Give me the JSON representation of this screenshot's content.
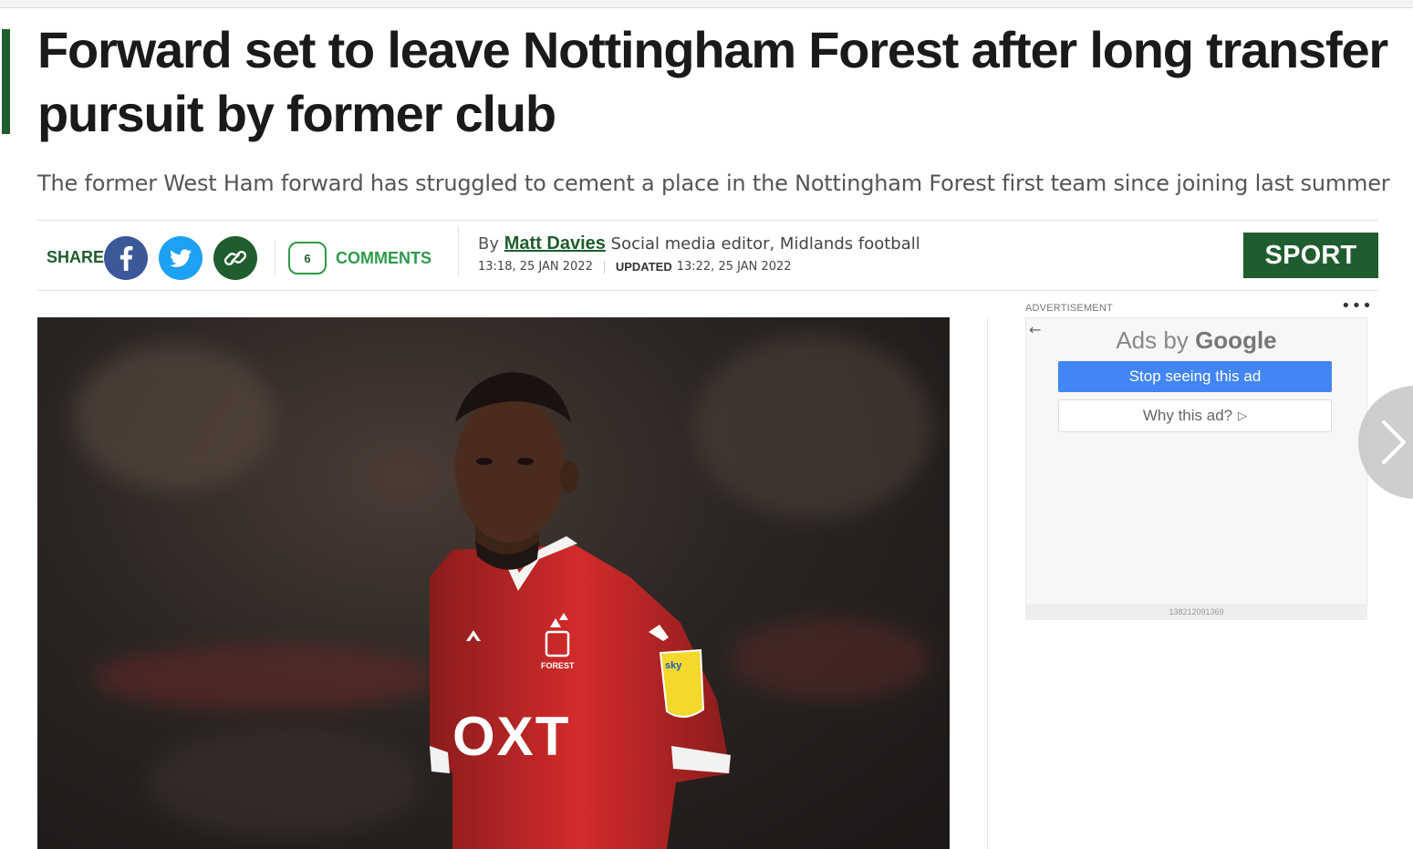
{
  "article": {
    "headline": "Forward set to leave Nottingham Forest after long transfer pursuit by former club",
    "standfirst": "The former West Ham forward has struggled to cement a place in the Nottingham Forest first team since joining last summer"
  },
  "share": {
    "label": "SHARE",
    "facebook_icon": "facebook-icon",
    "twitter_icon": "twitter-icon",
    "link_icon": "link-icon"
  },
  "comments": {
    "count": "6",
    "label": "COMMENTS"
  },
  "byline": {
    "prefix": "By",
    "author": "Matt Davies",
    "role": "Social media editor, Midlands football",
    "published": "13:18, 25 JAN 2022",
    "updated_label": "UPDATED",
    "updated": "13:22, 25 JAN 2022"
  },
  "section_tag": "SPORT",
  "hero_image": {
    "shirt_sponsor": "OXT",
    "badge_text": "FOREST",
    "sleeve_badge": "sky"
  },
  "advertisement": {
    "label": "ADVERTISEMENT",
    "ads_by": "Ads by",
    "google": "Google",
    "stop_button": "Stop seeing this ad",
    "why_button": "Why this ad?",
    "ad_id": "138212091369"
  },
  "colors": {
    "brand_green": "#1f5d2e",
    "comments_green": "#2e9b4a",
    "facebook": "#3b5998",
    "twitter": "#1da1f2",
    "google_blue": "#4285f4"
  }
}
